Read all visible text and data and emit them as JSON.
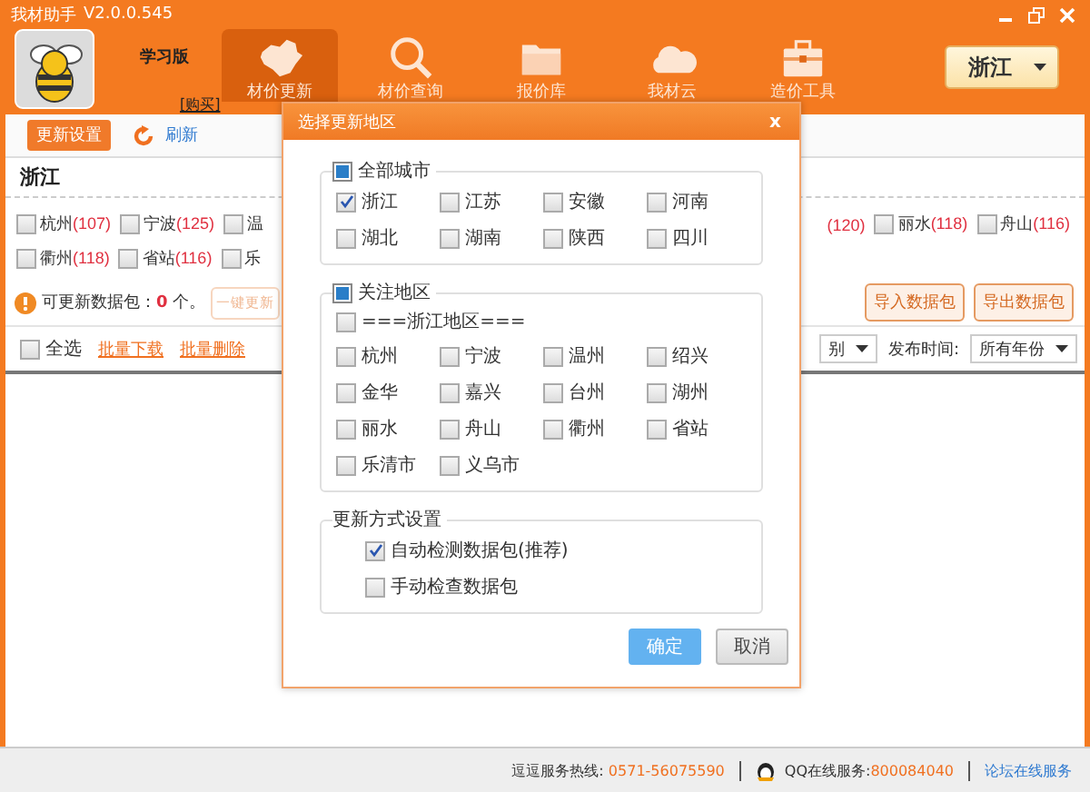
{
  "window": {
    "title": "我材助手",
    "version": "V2.0.0.545"
  },
  "header": {
    "edition": "学习版",
    "buy_link": "[购买]",
    "region": "浙江",
    "nav": [
      {
        "label": "材价更新",
        "selected": true
      },
      {
        "label": "材价查询",
        "selected": false
      },
      {
        "label": "报价库",
        "selected": false
      },
      {
        "label": "我材云",
        "selected": false
      },
      {
        "label": "造价工具",
        "selected": false
      }
    ]
  },
  "toolbar": {
    "buttons": [
      {
        "label": "更新设置",
        "kind": "primary"
      },
      {
        "label": "刷新",
        "kind": "refresh"
      }
    ]
  },
  "region_title": "浙江",
  "city_rows": [
    {
      "left": [
        {
          "name": "杭州",
          "count": "(107)",
          "checked": false
        },
        {
          "name": "宁波",
          "count": "(125)",
          "checked": false
        },
        {
          "name": "温",
          "checked": false
        }
      ],
      "right": [
        {
          "count": "(120)"
        },
        {
          "name": "丽水",
          "count": "(118)",
          "checked": false
        },
        {
          "name": "舟山",
          "count": "(116)",
          "checked": false
        }
      ]
    },
    {
      "left": [
        {
          "name": "衢州",
          "count": "(118)",
          "checked": false
        },
        {
          "name": "省站",
          "count": "(116)",
          "checked": false
        },
        {
          "name": "乐",
          "checked": false
        }
      ],
      "right": []
    }
  ],
  "package_bar": {
    "label": "可更新数据包：",
    "count": "0",
    "unit": "个。",
    "update_button": {
      "label": "一键更新",
      "disabled": true
    },
    "buttons": [
      "导入数据包",
      "导出数据包"
    ]
  },
  "list_bar": {
    "select_all": {
      "label": "全选",
      "checked": false
    },
    "links": [
      "批量下载",
      "批量删除"
    ],
    "filters": [
      {
        "kind": "select",
        "value": "别"
      },
      {
        "kind": "label",
        "text": "发布时间:"
      },
      {
        "kind": "select",
        "value": "所有年份"
      }
    ]
  },
  "status_bar": {
    "hotline_label": "逗逗服务热线:",
    "hotline": "0571-56075590",
    "qq_label": "QQ在线服务:",
    "qq": "800084040",
    "forum_link": "论坛在线服务"
  },
  "dialog": {
    "title": "选择更新地区",
    "close": "x",
    "groups": [
      {
        "title": "全部城市",
        "mixed": true,
        "kind": "grid",
        "items": [
          {
            "label": "浙江",
            "checked": true
          },
          {
            "label": "江苏",
            "checked": false
          },
          {
            "label": "安徽",
            "checked": false
          },
          {
            "label": "河南",
            "checked": false
          },
          {
            "label": "湖北",
            "checked": false
          },
          {
            "label": "湖南",
            "checked": false
          },
          {
            "label": "陕西",
            "checked": false
          },
          {
            "label": "四川",
            "checked": false
          }
        ]
      },
      {
        "title": "关注地区",
        "mixed": true,
        "kind": "grid",
        "header_item": {
          "label": "===浙江地区===",
          "checked": false
        },
        "items": [
          {
            "label": "杭州",
            "checked": false
          },
          {
            "label": "宁波",
            "checked": false
          },
          {
            "label": "温州",
            "checked": false
          },
          {
            "label": "绍兴",
            "checked": false
          },
          {
            "label": "金华",
            "checked": false
          },
          {
            "label": "嘉兴",
            "checked": false
          },
          {
            "label": "台州",
            "checked": false
          },
          {
            "label": "湖州",
            "checked": false
          },
          {
            "label": "丽水",
            "checked": false
          },
          {
            "label": "舟山",
            "checked": false
          },
          {
            "label": "衢州",
            "checked": false
          },
          {
            "label": "省站",
            "checked": false
          },
          {
            "label": "乐清市",
            "checked": false
          },
          {
            "label": "义乌市",
            "checked": false
          }
        ]
      },
      {
        "title": "更新方式设置",
        "kind": "list",
        "items": [
          {
            "label": "自动检测数据包(推荐)",
            "checked": true
          },
          {
            "label": "手动检查数据包",
            "checked": false
          }
        ]
      }
    ],
    "buttons": [
      {
        "label": "确定",
        "kind": "primary"
      },
      {
        "label": "取消",
        "kind": "secondary"
      }
    ]
  }
}
